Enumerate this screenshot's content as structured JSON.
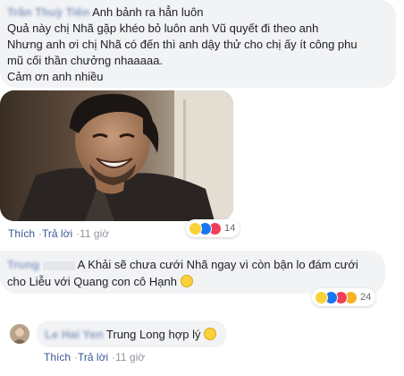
{
  "comment1": {
    "author": "Trần Thuỳ Tiên",
    "line1": "Anh bảnh ra hẳn luôn",
    "line2": "Quả này chị Nhã gặp khéo bỏ luôn anh Vũ quyết đi theo anh",
    "line3": "Nhưng anh ơi chị Nhã có đến thì anh dậy thử cho chị ấy ít công phu",
    "line4": "mũ cối thần chưởng nhaaaaa.",
    "line5": "Cảm ơn anh nhiều",
    "photo_icon": "man-laughing-photo",
    "like_label": "Thích",
    "reply_label": "Trả lời",
    "time": "11 giờ",
    "reaction_count": "14",
    "reaction_icons": [
      "haha-icon",
      "like-icon",
      "love-icon"
    ]
  },
  "comment2": {
    "author": "Trung",
    "line1": "A Khải sẽ chưa cưới Nhã ngay vì còn bận lo đám cưới",
    "line2": "cho Liễu với Quang con cô Hạnh",
    "reaction_count": "24",
    "reaction_icons": [
      "haha-icon",
      "like-icon",
      "love-icon",
      "wow-icon"
    ]
  },
  "reply": {
    "author": "Le Hai Yen",
    "text": "Trung Long hợp lý",
    "like_label": "Thích",
    "reply_label": "Trả lời",
    "time": "11 giờ"
  },
  "colors": {
    "bubble": "#f2f3f5",
    "link": "#385898",
    "meta": "#90949c",
    "like_blue": "#1877f2",
    "love_red": "#f33e58",
    "haha_yellow": "#fcd23a"
  }
}
